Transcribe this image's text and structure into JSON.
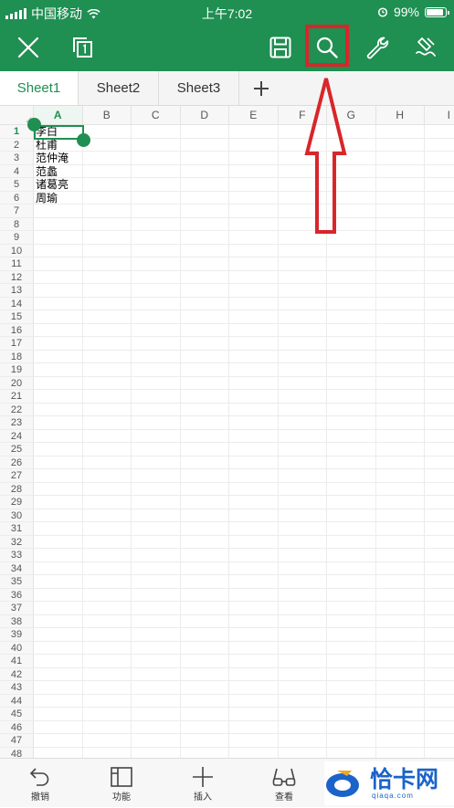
{
  "status_bar": {
    "carrier": "中国移动",
    "time": "上午7:02",
    "battery_percent": "99%",
    "battery_level": 0.99
  },
  "toolbar": {
    "icons": [
      "close-icon",
      "copy-icon",
      "save-icon",
      "search-icon",
      "wrench-icon",
      "pen-icon"
    ],
    "highlight_color": "#d8262a",
    "accent_color": "#1f8f52"
  },
  "tabs": [
    {
      "label": "Sheet1",
      "active": true
    },
    {
      "label": "Sheet2",
      "active": false
    },
    {
      "label": "Sheet3",
      "active": false
    }
  ],
  "grid": {
    "columns": [
      "A",
      "B",
      "C",
      "D",
      "E",
      "F",
      "G",
      "H",
      "I"
    ],
    "active_column": "A",
    "rows": [
      "1",
      "2",
      "3",
      "4",
      "5",
      "6",
      "7",
      "8",
      "9",
      "10",
      "11",
      "12",
      "13",
      "14",
      "15",
      "16",
      "17",
      "18",
      "19",
      "20",
      "21",
      "22",
      "23",
      "24",
      "25",
      "26",
      "27",
      "28",
      "29",
      "30",
      "31",
      "32",
      "33",
      "34",
      "35",
      "36",
      "37",
      "38",
      "39",
      "40",
      "41",
      "42",
      "43",
      "44",
      "45",
      "46",
      "47",
      "48"
    ],
    "active_row": "1",
    "cells_A": [
      "李白",
      "杜甫",
      "范仲淹",
      "范蠡",
      "诸葛亮",
      "周瑜"
    ],
    "selected_cell": "A1"
  },
  "bottom_bar": {
    "items": [
      {
        "label": "撤销",
        "icon": "undo-icon"
      },
      {
        "label": "功能",
        "icon": "panel-icon"
      },
      {
        "label": "插入",
        "icon": "plus-icon"
      },
      {
        "label": "查看",
        "icon": "glasses-icon"
      }
    ]
  },
  "watermark": {
    "title": "恰卡网",
    "subtitle": "qiaqa.com"
  }
}
